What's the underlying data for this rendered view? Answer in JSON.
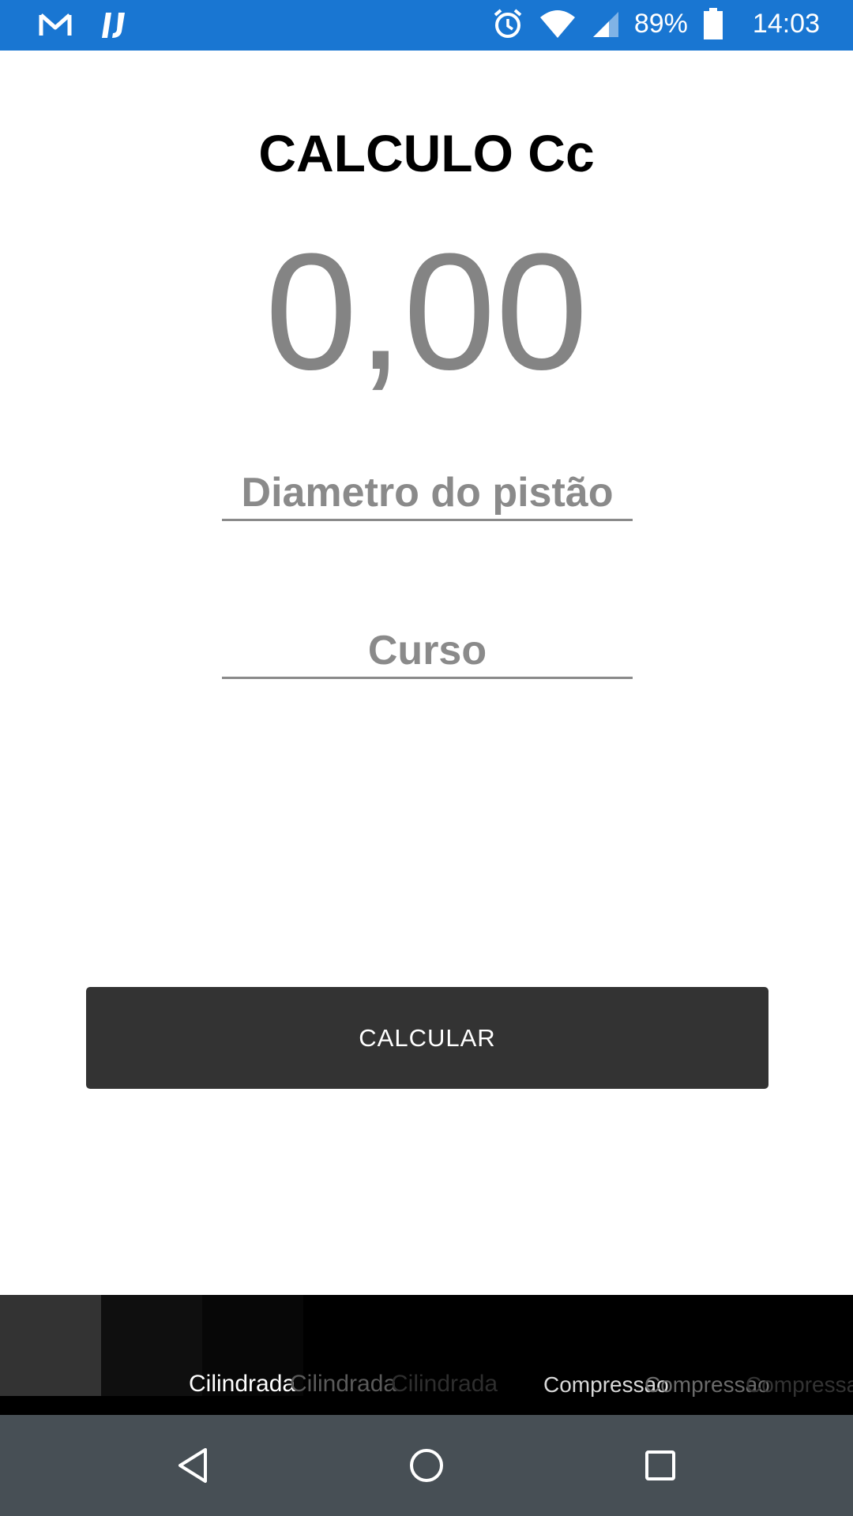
{
  "status_bar": {
    "icons_left": [
      "gmail-icon",
      "intellij-icon"
    ],
    "icons_right": [
      "alarm-icon",
      "wifi-icon",
      "signal-icon"
    ],
    "battery": "89%",
    "time": "14:03"
  },
  "main": {
    "title": "CALCULO Cc",
    "result": "0,00",
    "diameter_placeholder": "Diametro do pistão",
    "stroke_placeholder": "Curso",
    "calculate_label": "CALCULAR"
  },
  "tabs": {
    "labels": [
      "Cilindrada",
      "Cilindrada",
      "Cilindrada",
      "Compressao",
      "Compressao",
      "Compressao"
    ]
  },
  "colors": {
    "status_bar": "#1976d2",
    "button": "#333333",
    "result_text": "#848484",
    "nav_bar": "#474f55"
  }
}
